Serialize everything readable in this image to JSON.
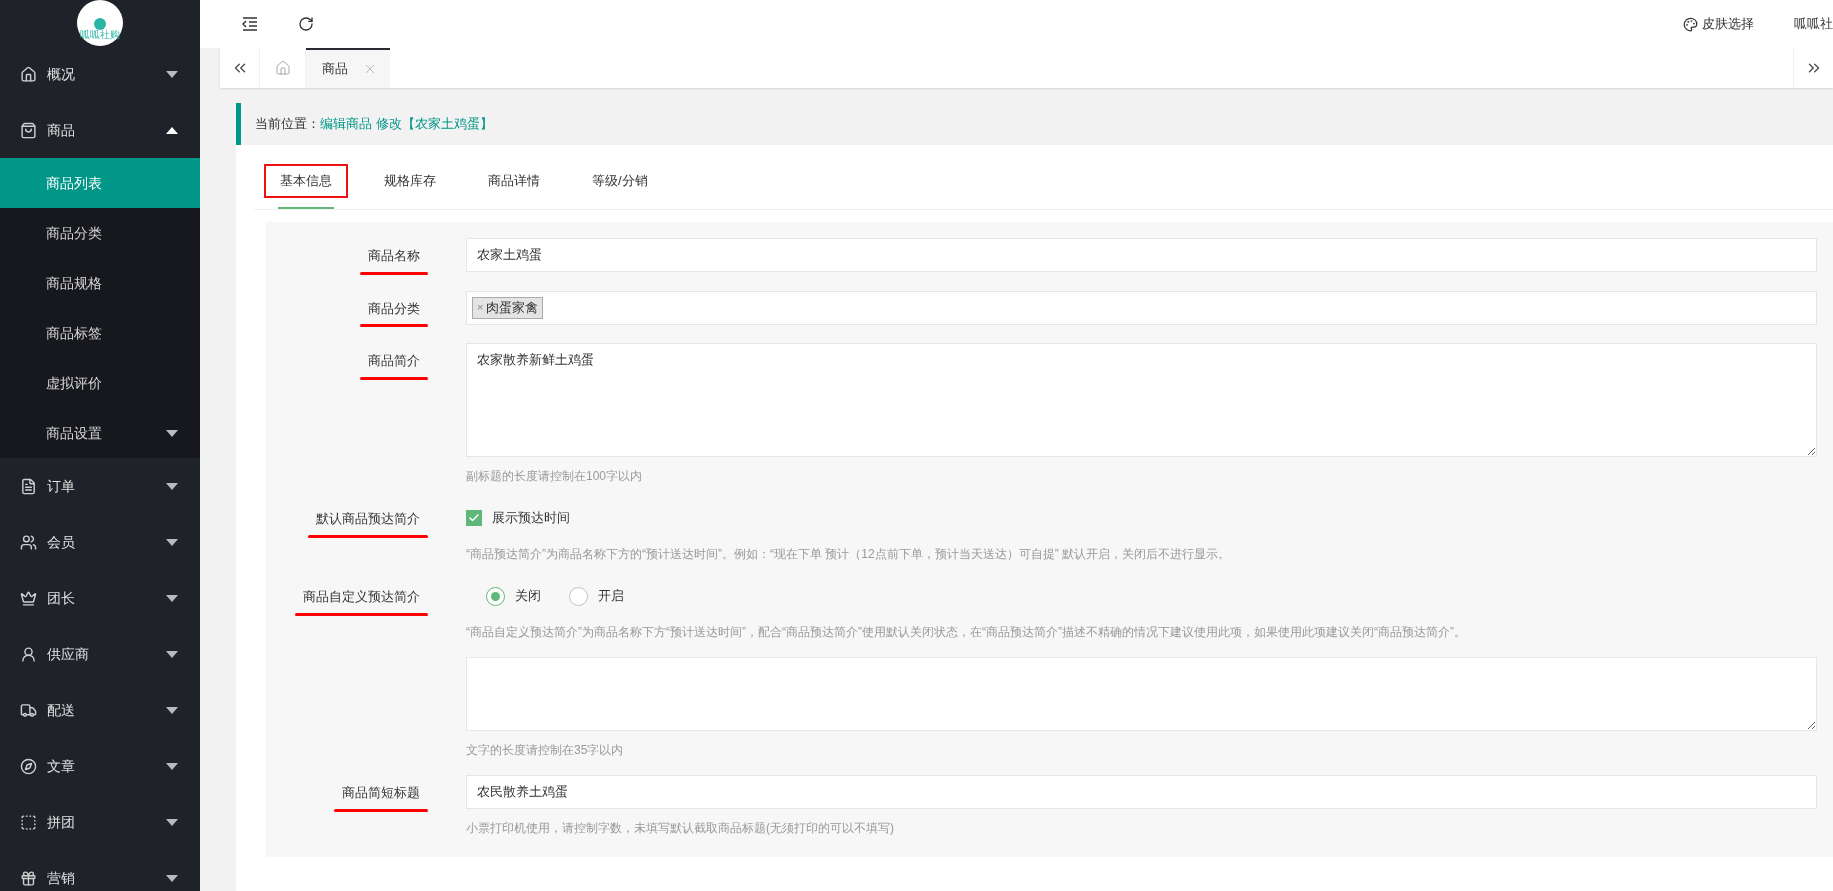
{
  "logo": {
    "text": "呱呱社购"
  },
  "sidebar": {
    "items": [
      {
        "label": "概况",
        "expanded": false
      },
      {
        "label": "商品",
        "expanded": true,
        "children": [
          {
            "label": "商品列表",
            "selected": true
          },
          {
            "label": "商品分类",
            "selected": false
          },
          {
            "label": "商品规格",
            "selected": false
          },
          {
            "label": "商品标签",
            "selected": false
          },
          {
            "label": "虚拟评价",
            "selected": false
          },
          {
            "label": "商品设置",
            "selected": false,
            "expanded": false
          }
        ]
      },
      {
        "label": "订单",
        "expanded": false
      },
      {
        "label": "会员",
        "expanded": false
      },
      {
        "label": "团长",
        "expanded": false
      },
      {
        "label": "供应商",
        "expanded": false
      },
      {
        "label": "配送",
        "expanded": false
      },
      {
        "label": "文章",
        "expanded": false
      },
      {
        "label": "拼团",
        "expanded": false
      },
      {
        "label": "营销",
        "expanded": false
      }
    ]
  },
  "topbar": {
    "skin": "皮肤选择",
    "user": "呱呱社"
  },
  "page_tabs": [
    {
      "label": "商品",
      "selected": true
    }
  ],
  "breadcrumb": {
    "label": "当前位置：",
    "path": "编辑商品 修改【农家土鸡蛋】"
  },
  "form_tabs": [
    {
      "label": "基本信息",
      "selected": true,
      "boxed": true
    },
    {
      "label": "规格库存",
      "selected": false,
      "boxed": false
    },
    {
      "label": "商品详情",
      "selected": false,
      "boxed": false
    },
    {
      "label": "等级/分销",
      "selected": false,
      "boxed": false
    }
  ],
  "fields": [
    {
      "kind": "input",
      "label": "商品名称",
      "underlined": true,
      "value": "农家土鸡蛋"
    },
    {
      "kind": "tags",
      "label": "商品分类",
      "underlined": true,
      "tags": [
        "肉蛋家禽"
      ],
      "remove": "×"
    },
    {
      "kind": "textarea",
      "label": "商品简介",
      "underlined": true,
      "value": "农家散养新鲜土鸡蛋",
      "hint": "副标题的长度请控制在100字以内"
    },
    {
      "kind": "checkbox",
      "label": "默认商品预达简介",
      "underlined": true,
      "option": "展示预达时间",
      "checked": true,
      "hint": "“商品预达简介”为商品名称下方的“预计送达时间”。例如：“现在下单 预计（12点前下单，预计当天送达）可自提” 默认开启，关闭后不进行显示。"
    },
    {
      "kind": "radio",
      "label": "商品自定义预达简介",
      "underlined": true,
      "options": [
        {
          "label": "关闭",
          "selected": true
        },
        {
          "label": "开启",
          "selected": false
        }
      ],
      "hint": "“商品自定义预达简介”为商品名称下方“预计送达时间”，配合“商品预达简介”使用默认关闭状态，在“商品预达简介”描述不精确的情况下建议使用此项，如果使用此项建议关闭“商品预达简介”。"
    },
    {
      "kind": "note",
      "hint": "文字的长度请控制在35字以内"
    },
    {
      "kind": "input",
      "label": "商品简短标题",
      "underlined": true,
      "value": "农民散养土鸡蛋",
      "hint": "小票打印机使用，请控制字数，未填写默认截取商品标题(无须打印的可以不填写)"
    }
  ]
}
